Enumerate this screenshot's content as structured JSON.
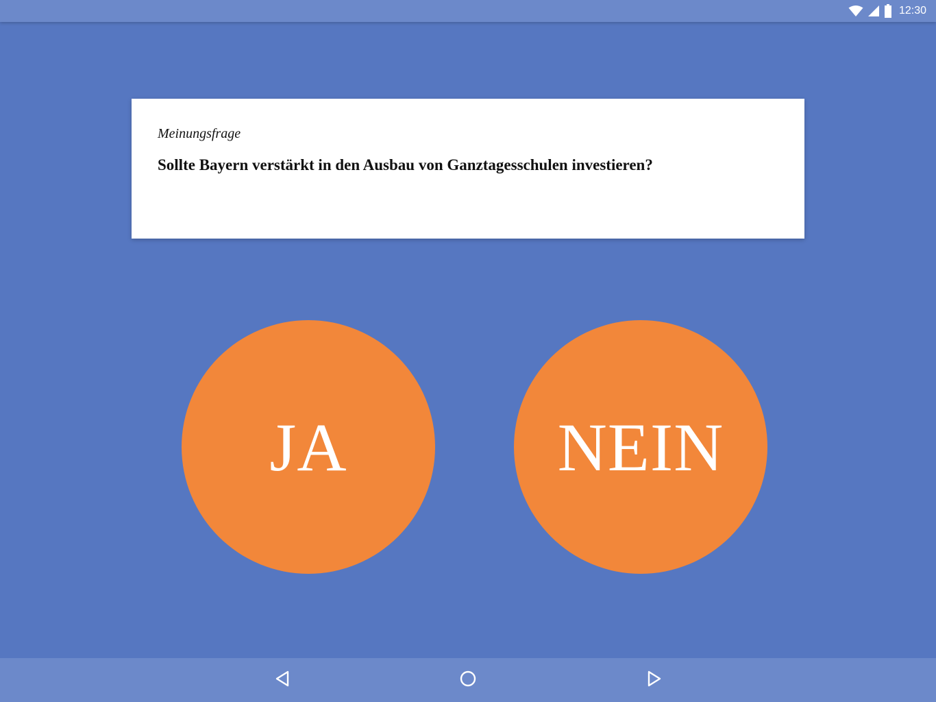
{
  "status_bar": {
    "time": "12:30",
    "icons": [
      "wifi-icon",
      "signal-icon",
      "battery-icon"
    ]
  },
  "card": {
    "label": "Meinungsfrage",
    "question": "Sollte Bayern verstärkt in den Ausbau von Ganztagesschulen investieren?"
  },
  "answers": {
    "yes_label": "JA",
    "no_label": "NEIN"
  },
  "nav_bar": {
    "icons": [
      "back-icon",
      "home-icon",
      "recents-icon"
    ]
  },
  "colors": {
    "background": "#5677c1",
    "bars": "#6c89ca",
    "accent": "#f2873a",
    "card": "#ffffff"
  }
}
